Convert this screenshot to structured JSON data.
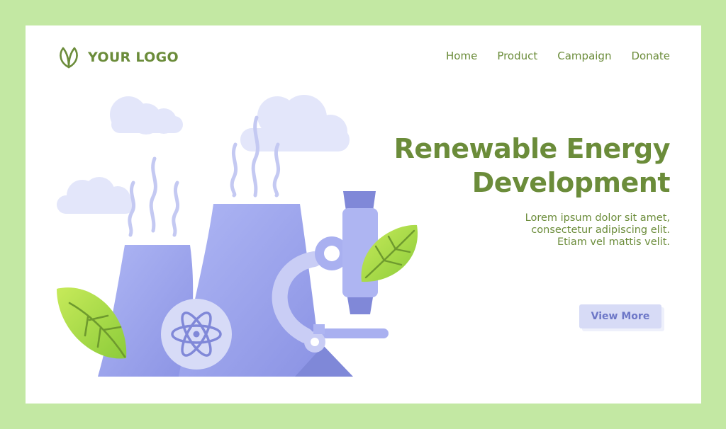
{
  "header": {
    "logo_text": "YOUR LOGO",
    "logo_icon": "leaf-icon",
    "nav": [
      {
        "label": "Home"
      },
      {
        "label": "Product"
      },
      {
        "label": "Campaign"
      },
      {
        "label": "Donate"
      }
    ]
  },
  "hero": {
    "title_line1": "Renewable Energy",
    "title_line2": "Development",
    "body_line1": "Lorem ipsum dolor sit amet,",
    "body_line2": "consectetur adipiscing elit.",
    "body_line3": "Etiam vel mattis velit.",
    "cta_label": "View More"
  },
  "illustration": {
    "elements": [
      "cloud-icon",
      "cooling-tower-icon",
      "atom-icon",
      "microscope-icon",
      "leaf-icon",
      "steam-icon"
    ]
  },
  "colors": {
    "background": "#c3e8a3",
    "card": "#ffffff",
    "brand_green": "#6b8c3a",
    "accent_periwinkle": "#8f98e6",
    "button_bg": "#d7dbf6",
    "leaf_green": "#9fd43f"
  }
}
